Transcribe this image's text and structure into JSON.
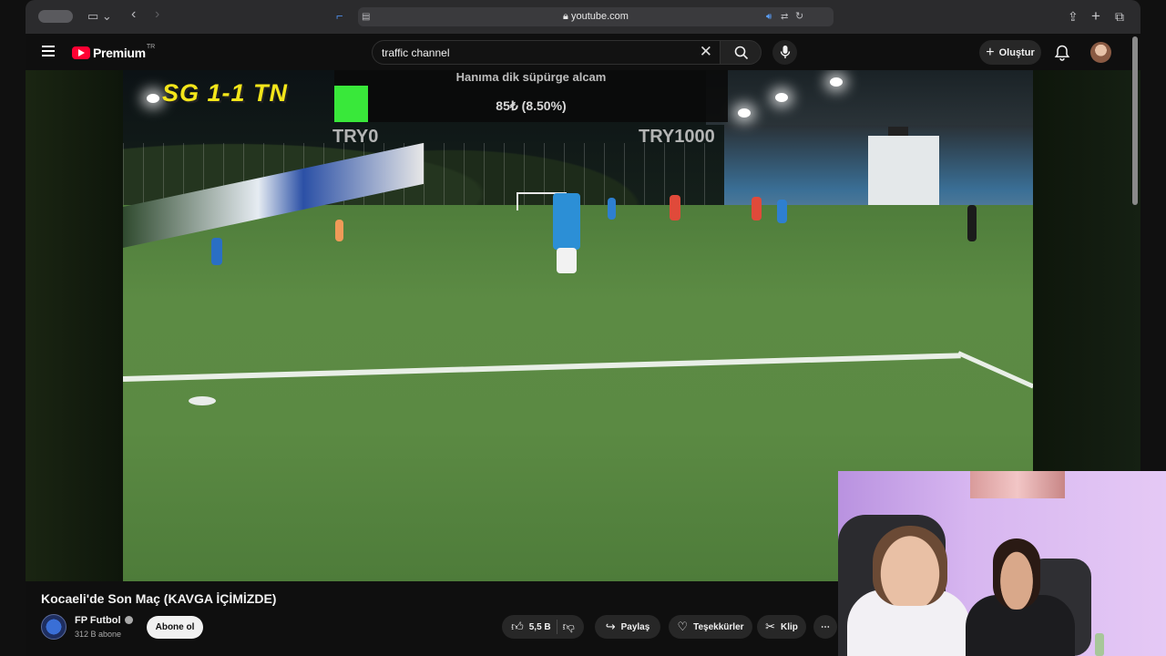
{
  "browser": {
    "url": "youtube.com",
    "icons": [
      "sidebar-icon",
      "back-icon",
      "forward-icon",
      "reader-icon",
      "lock-icon",
      "audio-icon",
      "translate-icon",
      "reload-icon",
      "share-icon",
      "new-tab-icon",
      "tabs-icon"
    ]
  },
  "masthead": {
    "logo_text": "Premium",
    "logo_country": "TR",
    "search_value": "traffic channel",
    "create_label": "Oluştur"
  },
  "overlay": {
    "score": "SG 1-1 TN",
    "donation_title": "Hanıma dik süpürge alcam",
    "donation_progress": "85₺ (8.50%)",
    "donation_fraction": 0.085,
    "goal_left": "TRY0",
    "goal_right": "TRY1000",
    "accent_color": "#39e83a"
  },
  "video": {
    "title": "Kocaeli'de Son Maç (KAVGA İÇİMİZDE)"
  },
  "channel": {
    "name": "FP Futbol",
    "subscribers": "312 B abone",
    "subscribe_label": "Abone ol"
  },
  "actions": {
    "likes": "5,5 B",
    "share": "Paylaş",
    "thanks": "Teşekkürler",
    "clip": "Klip",
    "more": "⋯"
  }
}
